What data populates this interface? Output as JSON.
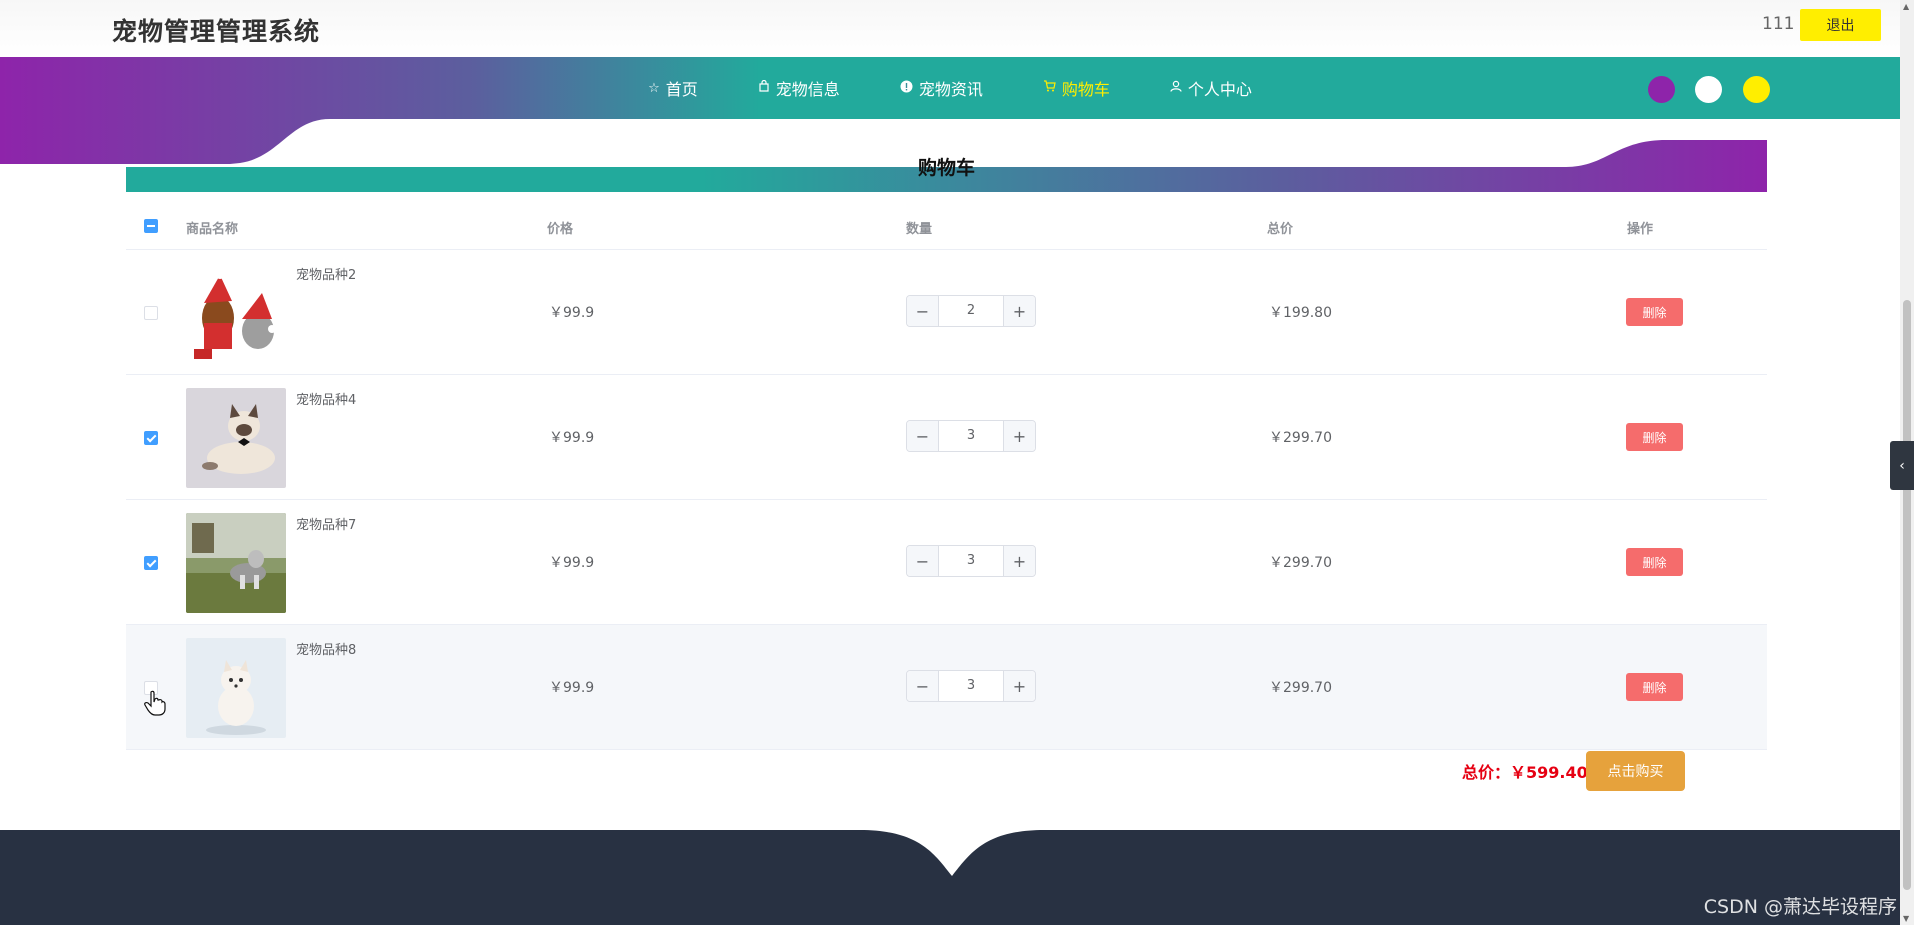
{
  "header": {
    "site_title": "宠物管理管理系统",
    "username": "111",
    "logout_label": "退出"
  },
  "nav": {
    "items": [
      {
        "label": "首页",
        "icon": "star-icon",
        "active": false
      },
      {
        "label": "宠物信息",
        "icon": "bag-icon",
        "active": false
      },
      {
        "label": "宠物资讯",
        "icon": "info-icon",
        "active": false
      },
      {
        "label": "购物车",
        "icon": "cart-icon",
        "active": true
      },
      {
        "label": "个人中心",
        "icon": "user-icon",
        "active": false
      }
    ],
    "theme_dots": [
      "#8e24aa",
      "#ffffff",
      "#ffee00"
    ]
  },
  "page": {
    "title": "购物车"
  },
  "table": {
    "columns": [
      "商品名称",
      "价格",
      "数量",
      "总价",
      "操作"
    ],
    "rows": [
      {
        "name": "宠物品种2",
        "price": "￥99.9",
        "quantity": "2",
        "total": "￥199.80",
        "checked": false,
        "action": "删除"
      },
      {
        "name": "宠物品种4",
        "price": "￥99.9",
        "quantity": "3",
        "total": "￥299.70",
        "checked": true,
        "action": "删除"
      },
      {
        "name": "宠物品种7",
        "price": "￥99.9",
        "quantity": "3",
        "total": "￥299.70",
        "checked": true,
        "action": "删除"
      },
      {
        "name": "宠物品种8",
        "price": "￥99.9",
        "quantity": "3",
        "total": "￥299.70",
        "checked": false,
        "action": "删除"
      }
    ]
  },
  "summary": {
    "total_label": "总价：￥599.40",
    "buy_label": "点击购买"
  },
  "watermark": "CSDN @萧达毕设程序",
  "colors": {
    "purple": "#8e24aa",
    "teal": "#22aa9c",
    "active_nav": "#ffee00",
    "danger": "#f56c6c",
    "warning": "#e6a23c",
    "footer": "#283142"
  }
}
